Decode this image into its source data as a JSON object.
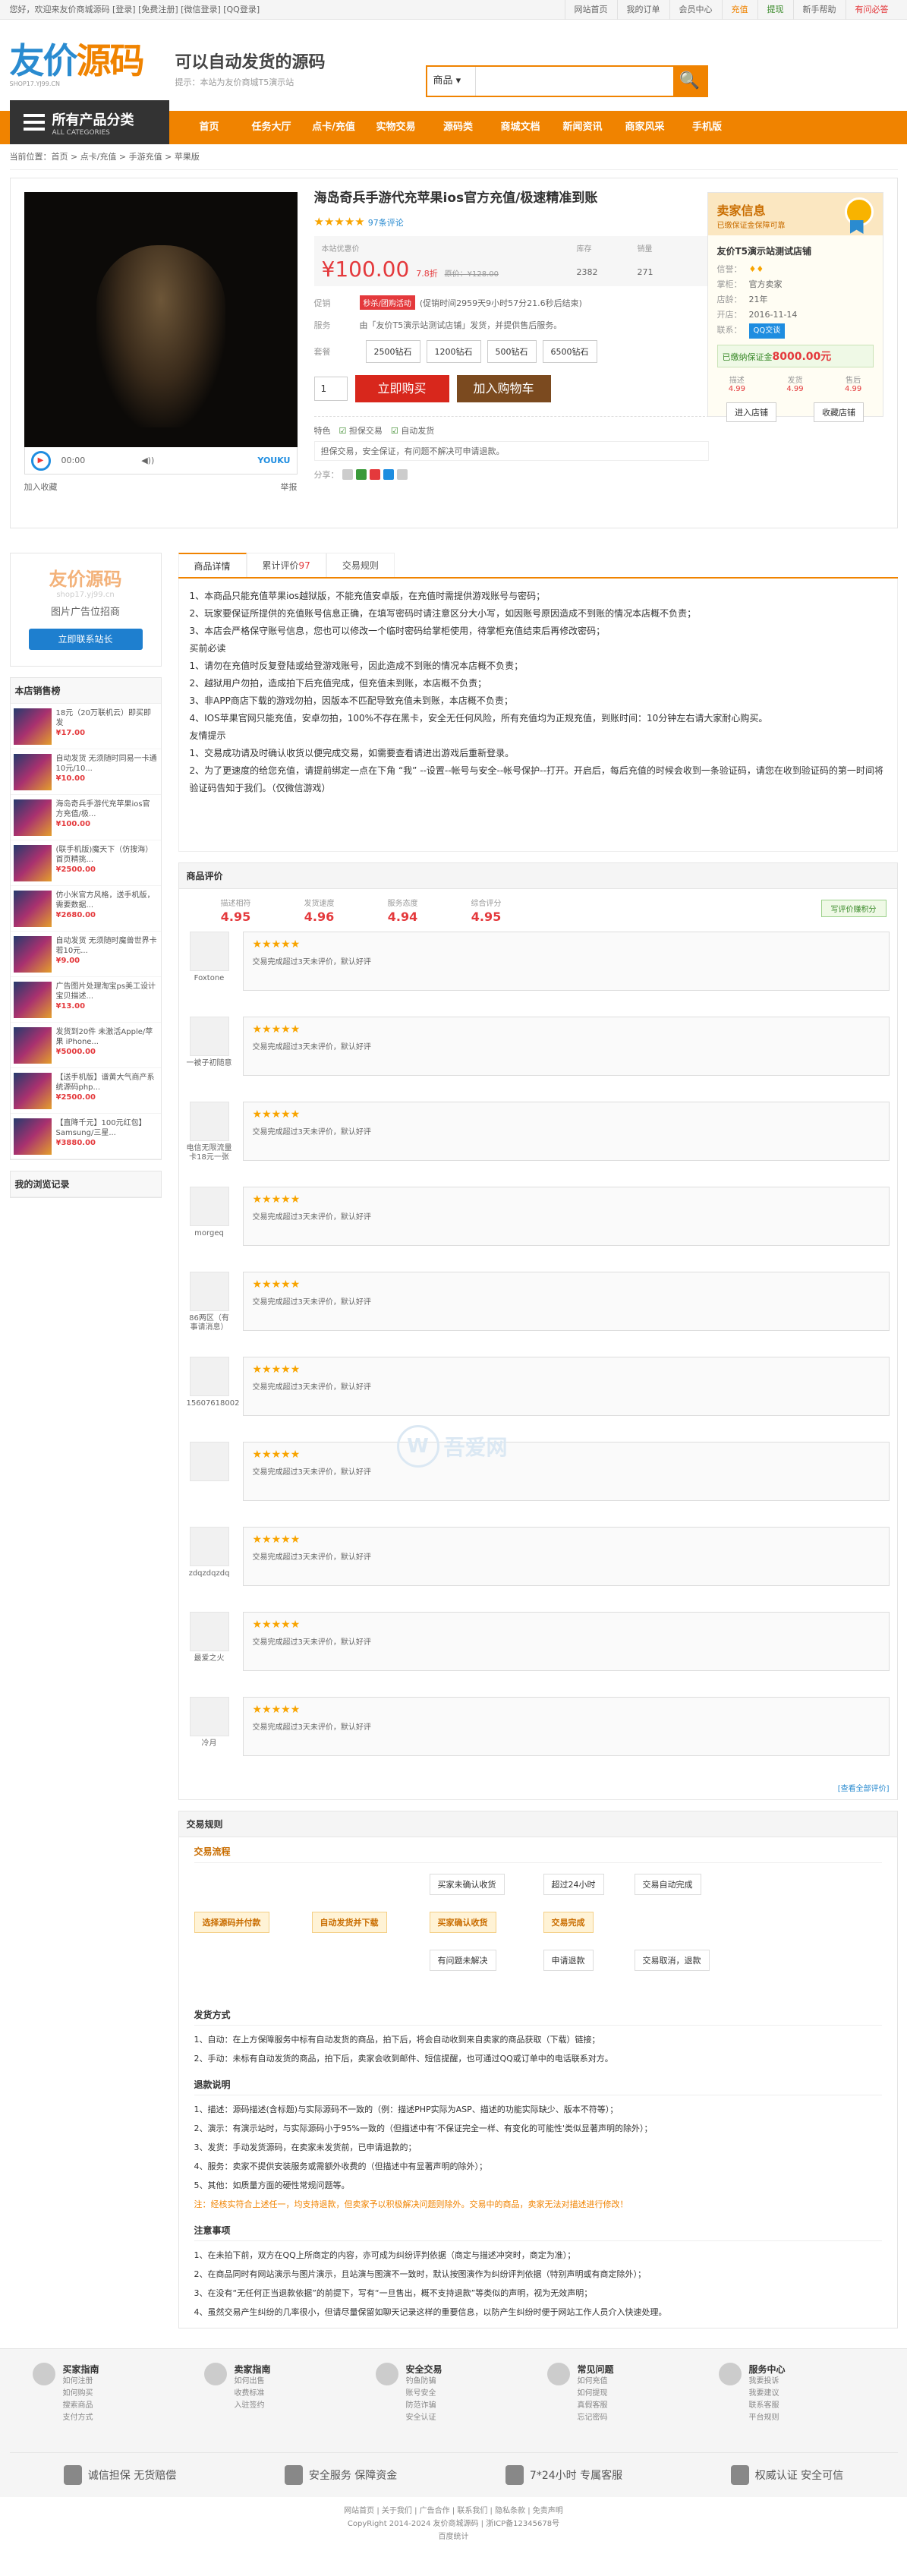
{
  "topbar": {
    "left": "您好，欢迎来友价商城源码 [登录] [免费注册] [微信登录] [QQ登录]",
    "links": [
      "网站首页",
      "我的订单",
      "会员中心",
      "充值",
      "提现",
      "新手帮助",
      "有问必答"
    ]
  },
  "header": {
    "logo_a": "友价",
    "logo_b": "源码",
    "logo_sub": "SHOP17.YJ99.CN",
    "slogan": "可以自动发货的源码",
    "slogan_sub": "提示：本站为友价商城T5演示站",
    "search_type": "商品",
    "search_placeholder": "",
    "search_btn": "🔍"
  },
  "nav": {
    "all": "所有产品分类",
    "all_sub": "ALL CATEGORIES",
    "items": [
      "首页",
      "任务大厅",
      "点卡/充值",
      "实物交易",
      "源码类",
      "商城文档",
      "新闻资讯",
      "商家风采",
      "手机版"
    ]
  },
  "crumb": "当前位置：首页 > 点卡/充值 > 手游充值 > 苹果版",
  "product": {
    "title": "海岛奇兵手游代充苹果ios官方充值/极速精准到账",
    "stars": "★★★★★",
    "reviews": "97条评论",
    "price_label": "本站优惠价",
    "price": "¥100.00",
    "discount": "7.8折",
    "orig_label": "原价：",
    "orig": "¥128.00",
    "stock_label": "库存",
    "stock": "2382",
    "sold_label": "销量",
    "sold": "271",
    "promo_label": "促销",
    "promo_tag": "秒杀/团购活动",
    "promo_text": "(促销时间2959天9小时57分21.6秒后结束)",
    "service_label": "服务",
    "service": "由「友价T5演示站测试店铺」发货，并提供售后服务。",
    "pkg_label": "套餐",
    "pkgs": [
      "2500钻石",
      "1200钻石",
      "500钻石",
      "6500钻石"
    ],
    "qty": "1",
    "buy": "立即购买",
    "cart": "加入购物车",
    "feat_label": "特色",
    "feats": [
      "担保交易",
      "自动发货"
    ],
    "feat_note": "担保交易，安全保证，有问题不解决可申请退款。",
    "share": "分享：",
    "video": {
      "time": "00:00",
      "brand": "YOUKU"
    },
    "fav": "加入收藏",
    "report": "举报"
  },
  "seller": {
    "title": "卖家信息",
    "sub": "已缴保证金保障可靠",
    "name": "友价T5演示站测试店铺",
    "rows": [
      [
        "信誉：",
        ""
      ],
      [
        "掌柜：",
        "官方卖家"
      ],
      [
        "店龄：",
        "21年"
      ],
      [
        "开店：",
        "2016-11-14"
      ],
      [
        "联系：",
        ""
      ]
    ],
    "qq": "QQ交谈",
    "deposit_pre": "已缴纳保证金",
    "deposit": "8000.00元",
    "scores": [
      [
        "描述",
        "4.99"
      ],
      [
        "发货",
        "4.99"
      ],
      [
        "售后",
        "4.99"
      ]
    ],
    "btns": [
      "进入店铺",
      "收藏店铺"
    ]
  },
  "sidebar": {
    "ad_title": "友价源码",
    "ad_sub": "shop17.yj99.cn",
    "ad_text": "图片广告位招商",
    "ad_btn": "立即联系站长",
    "sales_title": "本店销售榜",
    "sales": [
      {
        "t": "18元（20万联机云）即买即发",
        "p": "¥17.00"
      },
      {
        "t": "自动发货 无须随时同易一卡通10元/10...",
        "p": "¥10.00"
      },
      {
        "t": "海岛奇兵手游代充苹果ios官方充值/极...",
        "p": "¥100.00"
      },
      {
        "t": "(联手机版)魔天下（仿搜海）首页精挑...",
        "p": "¥2500.00"
      },
      {
        "t": "仿小米官方风格，送手机版，需要数据...",
        "p": "¥2680.00"
      },
      {
        "t": "自动发货 无须随时魔兽世界卡若10元...",
        "p": "¥9.00"
      },
      {
        "t": "广告图片处理淘宝ps美工设计宝贝描述...",
        "p": "¥13.00"
      },
      {
        "t": "发货到20件 未激活Apple/苹果 iPhone...",
        "p": "¥5000.00"
      },
      {
        "t": "【送手机版】谱黄大气商产系统源码php...",
        "p": "¥2500.00"
      },
      {
        "t": "【直降千元】100元红包】Samsung/三星...",
        "p": "¥3880.00"
      }
    ],
    "history": "我的浏览记录"
  },
  "tabs": {
    "detail": "商品详情",
    "count_pre": "累计评价",
    "count": "97",
    "rules": "交易规则"
  },
  "detail_lines": [
    "1、本商品只能充值苹果ios越狱版，不能充值安卓版，在充值时需提供游戏账号与密码；",
    "2、玩家要保证所提供的充值账号信息正确，在填写密码时请注意区分大小写，如因账号原因造成不到账的情况本店概不负责；",
    "3、本店会严格保守账号信息，您也可以修改一个临时密码给掌柜使用，待掌柜充值结束后再修改密码；",
    "买前必读",
    "1、请勿在充值时反复登陆或给登游戏账号，因此造成不到账的情况本店概不负责；",
    "2、越狱用户勿拍，造成拍下后充值完成，但充值未到账，本店概不负责；",
    "3、非APP商店下载的游戏勿拍，因版本不匹配导致充值未到账，本店概不负责；",
    "4、IOS苹果官网只能充值，安卓勿拍，100%不存在黑卡，安全无任何风险，所有充值均为正规充值，到账时间：10分钟左右请大家耐心购买。",
    "友情提示",
    "1、交易成功请及时确认收货以便完成交易，如需要查看请进出游戏后重新登录。",
    "2、为了更速度的给您充值，请提前绑定一点在下角 “我” --设置--帐号与安全--帐号保护--打开。开启后，每后充值的时候会收到一条验证码，请您在收到验证码的第一时间将验证码告知于我们。（仅微信游戏）"
  ],
  "reviews": {
    "title": "商品评价",
    "scores": [
      [
        "描述相符",
        "4.95"
      ],
      [
        "发货速度",
        "4.96"
      ],
      [
        "服务态度",
        "4.94"
      ],
      [
        "综合评分",
        "4.95"
      ]
    ],
    "write": "写评价赚积分",
    "text": "交易完成超过3天未评价，默认好评",
    "users": [
      "Foxtone",
      "一被子初随意",
      "电信无限流量卡18元一张",
      "morgeq",
      "86两区（有事请消息）",
      "15607618002",
      "",
      "zdqzdqzdq",
      "最爱之火",
      "冷月"
    ],
    "more": "[查看全部评价]"
  },
  "trade": {
    "title": "交易规则",
    "flow_title": "交易流程",
    "nodes": {
      "pay": "选择源码并付款",
      "auto": "自动发货并下载",
      "n1": "买家未确认收货",
      "n2": "超过24小时",
      "n3": "交易自动完成",
      "confirm": "买家确认收货",
      "done": "交易完成",
      "n4": "有问题未解决",
      "n5": "申请退款",
      "n6": "交易取消，退款"
    },
    "ship_title": "发货方式",
    "ship": [
      "1、自动：在上方保障服务中标有自动发货的商品，拍下后，将会自动收到来自卖家的商品获取（下载）链接；",
      "2、手动：未标有自动发货的商品，拍下后，卖家会收到邮件、短信提醒，也可通过QQ或订单中的电话联系对方。"
    ],
    "refund_title": "退款说明",
    "refund": [
      "1、描述：源码描述(含标题)与实际源码不一致的（例：描述PHP实际为ASP、描述的功能实际缺少、版本不符等）；",
      "2、演示：有演示站时，与实际源码小于95%一致的（但描述中有'不保证完全一样、有变化的可能性'类似显著声明的除外）；",
      "3、发货：手动发货源码，在卖家未发货前，已申请退款的；",
      "4、服务：卖家不提供安装服务或需额外收费的（但描述中有显著声明的除外）；",
      "5、其他：如质量方面的硬性常规问题等。"
    ],
    "refund_note": "注：经核实符合上述任一，均支持退款，但卖家予以积极解决问题则除外。交易中的商品，卖家无法对描述进行修改！",
    "note_title": "注意事项",
    "notes": [
      "1、在未拍下前，双方在QQ上所商定的内容，亦可成为纠纷评判依据（商定与描述冲突时，商定为准）；",
      "2、在商品同时有网站演示与图片演示，且站演与图演不一致时，默认按图演作为纠纷评判依据（特别声明或有商定除外）；",
      "3、在没有“无任何正当退款依据”的前提下，写有“一旦售出，概不支持退款”等类似的声明，视为无效声明；",
      "4、虽然交易产生纠纷的几率很小，但请尽量保留如聊天记录这样的重要信息，以防产生纠纷时便于网站工作人员介入快速处理。"
    ]
  },
  "footer": {
    "cols": [
      {
        "h": "买家指南",
        "p": [
          "如何注册",
          "如何购买",
          "搜索商品",
          "支付方式"
        ]
      },
      {
        "h": "卖家指南",
        "p": [
          "如何出售",
          "收费标准",
          "入驻签约"
        ]
      },
      {
        "h": "安全交易",
        "p": [
          "钓鱼防骗",
          "账号安全",
          "防范诈骗",
          "安全认证"
        ]
      },
      {
        "h": "常见问题",
        "p": [
          "如何充值",
          "如何提现",
          "真假客服",
          "忘记密码"
        ]
      },
      {
        "h": "服务中心",
        "p": [
          "我要投诉",
          "我要建议",
          "联系客服",
          "平台规则"
        ]
      }
    ],
    "guar": [
      "诚信担保 无货赔偿",
      "安全服务 保障资金",
      "7*24小时 专属客服",
      "权威认证 安全可信"
    ],
    "copy": [
      "网站首页 | 关于我们 | 广告合作 | 联系我们 | 隐私条款 | 免责声明",
      "CopyRight 2014-2024 友价商城源码 | 浙ICP备12345678号",
      "百度统计"
    ]
  },
  "watermark": "吾爱网"
}
